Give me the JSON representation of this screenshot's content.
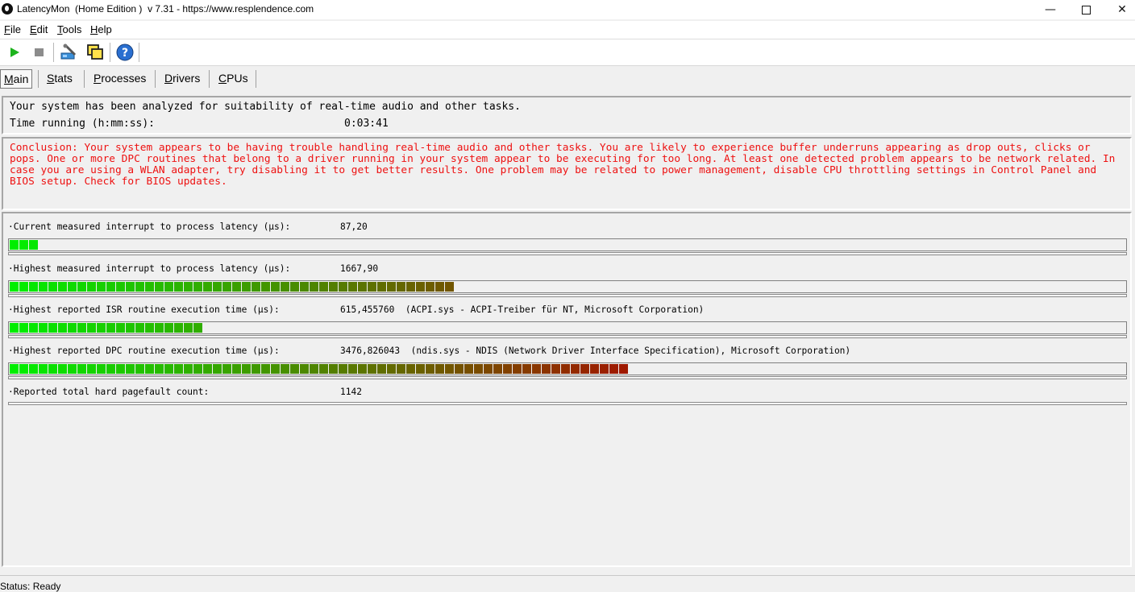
{
  "window": {
    "title": "LatencyMon  (Home Edition )  v 7.31 - https://www.resplendence.com"
  },
  "menu": [
    {
      "mnemonic": "F",
      "rest": "ile"
    },
    {
      "mnemonic": "E",
      "rest": "dit"
    },
    {
      "mnemonic": "T",
      "rest": "ools"
    },
    {
      "mnemonic": "H",
      "rest": "elp"
    }
  ],
  "toolbar_icons": [
    "play-icon",
    "stop-icon",
    "wrench-tool-icon",
    "window-stack-icon",
    "help-icon"
  ],
  "tabs": [
    {
      "mnemonic": "M",
      "rest": "ain",
      "active": true
    },
    {
      "mnemonic": "S",
      "rest": "tats",
      "active": false
    },
    {
      "mnemonic": "P",
      "rest": "rocesses",
      "active": false
    },
    {
      "mnemonic": "D",
      "rest": "rivers",
      "active": false
    },
    {
      "mnemonic": "C",
      "rest": "PUs",
      "active": false
    }
  ],
  "system": {
    "analysis_text": "Your system has been analyzed for suitability of real-time audio and other tasks.",
    "time_label": "Time running (h:mm:ss):",
    "time_value": "0:03:41"
  },
  "conclusion": "Conclusion: Your system appears to be having trouble handling real-time audio and other tasks. You are likely to experience buffer underruns appearing as drop outs, clicks or pops. One or more DPC routines that belong to a driver running in your system appear to be executing for too long. At least one detected problem appears to be network related. In case you are using a WLAN adapter, try disabling it to get better results. One problem may be related to power management, disable CPU throttling settings in Control Panel and BIOS setup. Check for BIOS updates.",
  "colors": {
    "conclusion_text": "#ee1111",
    "bar_green": "#00ee00",
    "bar_red": "#a01800"
  },
  "metrics": [
    {
      "label": "·Current measured interrupt to process latency (µs):",
      "value": "87,20",
      "detail": "",
      "bar_fraction": 0.027
    },
    {
      "label": "·Highest measured interrupt to process latency (µs):",
      "value": "1667,90",
      "detail": "",
      "bar_fraction": 0.397
    },
    {
      "label": "·Highest reported ISR routine execution time (µs):",
      "value": "615,455760",
      "detail": "(ACPI.sys - ACPI-Treiber für NT, Microsoft Corporation)",
      "bar_fraction": 0.172
    },
    {
      "label": "·Highest reported DPC routine execution time (µs):",
      "value": "3476,826043",
      "detail": "(ndis.sys - NDIS (Network Driver Interface Specification), Microsoft Corporation)",
      "bar_fraction": 0.553
    },
    {
      "label": "·Reported total hard pagefault count:",
      "value": "1142",
      "detail": "",
      "bar_fraction": null
    }
  ],
  "status": "Status: Ready"
}
